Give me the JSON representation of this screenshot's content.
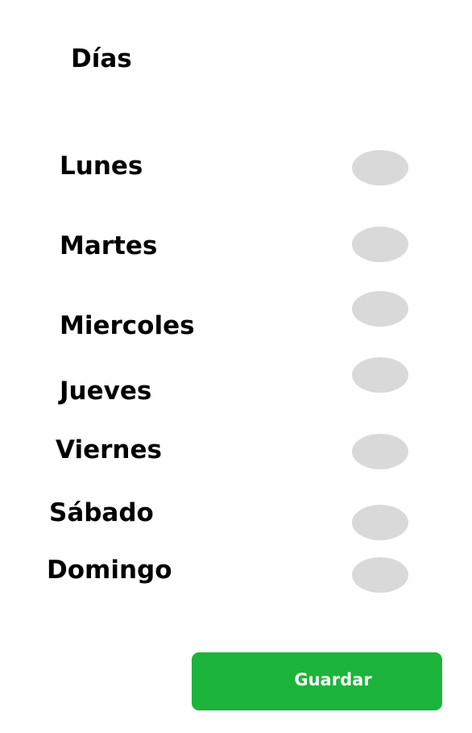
{
  "header": {
    "title": "Días"
  },
  "days": [
    {
      "label": "Lunes",
      "enabled": false
    },
    {
      "label": "Martes",
      "enabled": false
    },
    {
      "label": "Miercoles",
      "enabled": false
    },
    {
      "label": "Jueves",
      "enabled": false
    },
    {
      "label": "Viernes",
      "enabled": false
    },
    {
      "label": "Sábado",
      "enabled": false
    },
    {
      "label": "Domingo",
      "enabled": false
    }
  ],
  "actions": {
    "save_label": "Guardar"
  },
  "colors": {
    "toggle_off": "#d9d9d9",
    "save_button": "#1cb43a",
    "text": "#000000"
  }
}
